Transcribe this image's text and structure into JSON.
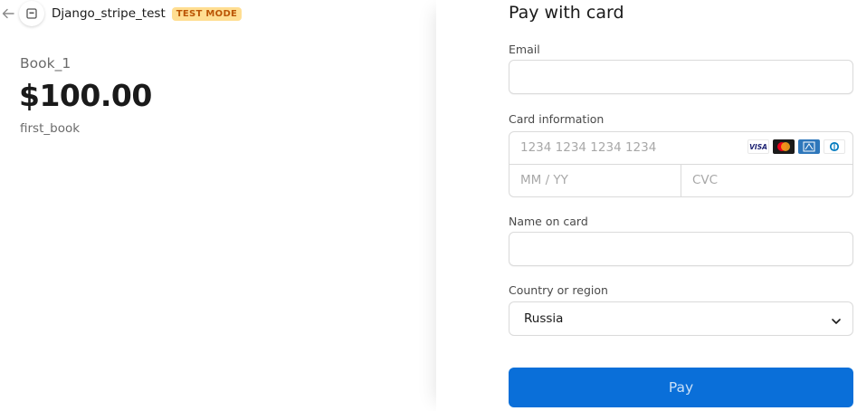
{
  "header": {
    "merchant_name": "Django_stripe_test",
    "badge": "TEST MODE"
  },
  "product": {
    "name": "Book_1",
    "price": "$100.00",
    "description": "first_book"
  },
  "form": {
    "title": "Pay with card",
    "email_label": "Email",
    "card_label": "Card information",
    "card_number_placeholder": "1234 1234 1234 1234",
    "expiry_placeholder": "MM / YY",
    "cvc_placeholder": "CVC",
    "card_brands": [
      "VISA",
      "mastercard",
      "amex",
      "diners"
    ],
    "name_label": "Name on card",
    "country_label": "Country or region",
    "country_value": "Russia",
    "pay_label": "Pay"
  },
  "colors": {
    "accent": "#0a6fd9",
    "badge_bg": "#ffde92",
    "badge_text": "#bb5504"
  }
}
